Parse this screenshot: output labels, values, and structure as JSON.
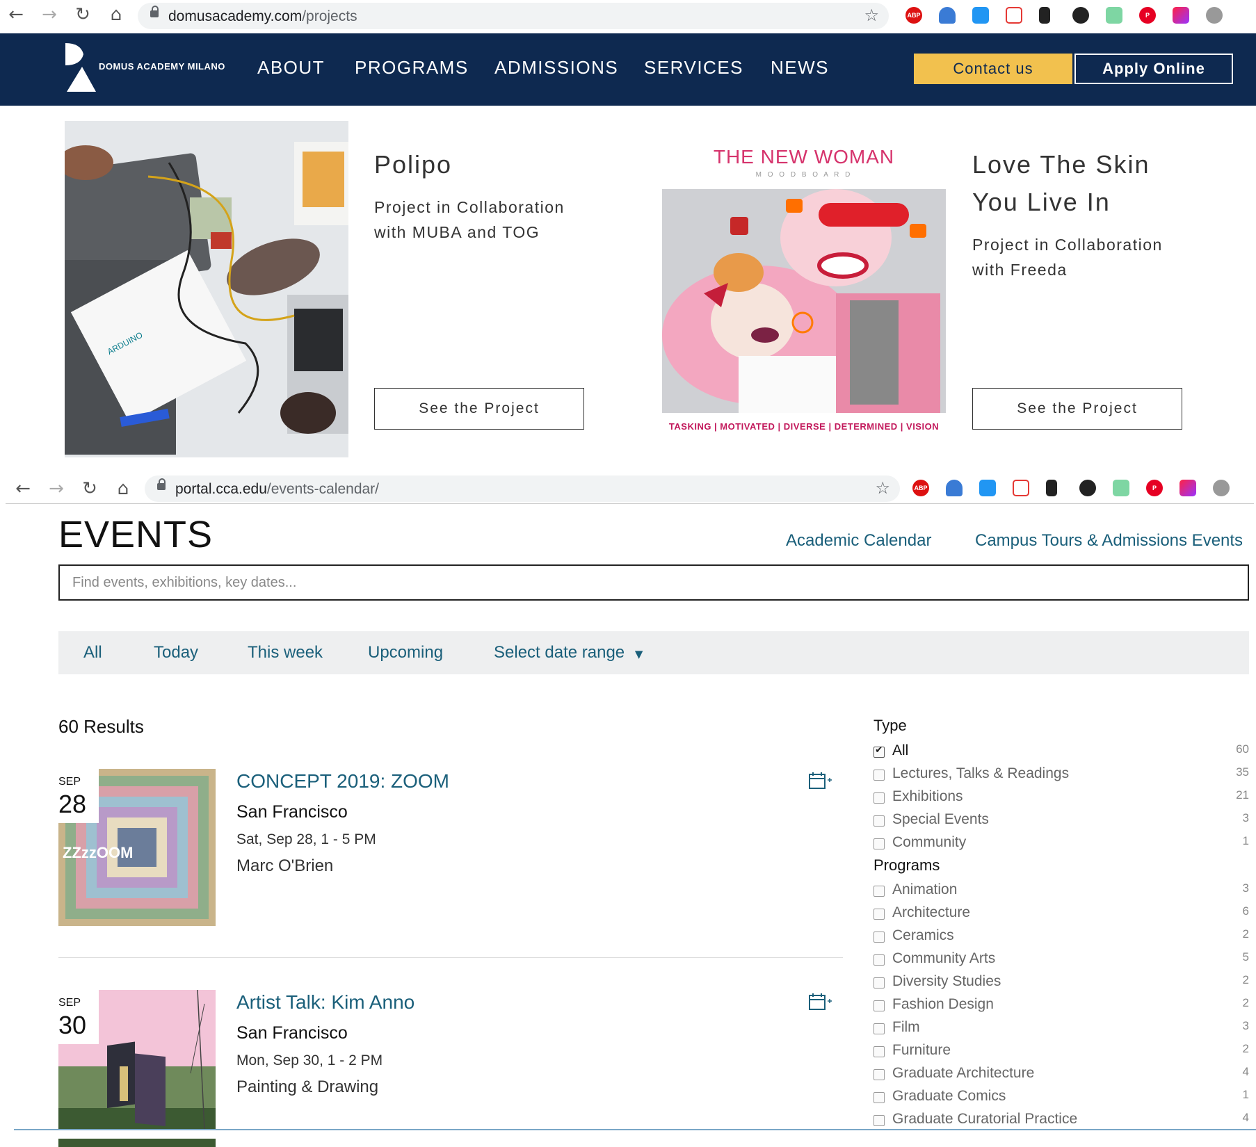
{
  "browser1": {
    "url_host": "domusacademy.com",
    "url_path": "/projects"
  },
  "domus": {
    "brand": "DOMUS ACADEMY MILANO",
    "nav": [
      "ABOUT",
      "PROGRAMS",
      "ADMISSIONS",
      "SERVICES",
      "NEWS"
    ],
    "contact_label": "Contact us",
    "apply_label": "Apply Online",
    "projects": [
      {
        "title": "Polipo",
        "desc_line1": "Project in Collaboration",
        "desc_line2": "with MUBA and TOG",
        "button": "See the Project"
      },
      {
        "title_line1": "Love The Skin",
        "title_line2": "You Live In",
        "desc_line1": "Project in Collaboration",
        "desc_line2": "with Freeda",
        "button": "See the Project",
        "image_title": "THE NEW WOMAN",
        "image_subtitle": "M O O D B O A R D",
        "image_caption": "TASKING | MOTIVATED | DIVERSE | DETERMINED | VISION"
      }
    ],
    "polipo_image_text": "ARDUINO"
  },
  "browser2": {
    "url_host": "portal.cca.edu",
    "url_path": "/events-calendar/"
  },
  "cca": {
    "title": "EVENTS",
    "links": [
      "Academic Calendar",
      "Campus Tours & Admissions Events"
    ],
    "search_placeholder": "Find events, exhibitions, key dates...",
    "filters": [
      "All",
      "Today",
      "This week",
      "Upcoming",
      "Select date range"
    ],
    "results": "60 Results",
    "events": [
      {
        "month": "SEP",
        "day": "28",
        "title": "CONCEPT 2019: ZOOM",
        "location": "San Francisco",
        "time": "Sat, Sep 28, 1 - 5 PM",
        "tag": "Marc O'Brien",
        "image_text": "ZZzzOOM"
      },
      {
        "month": "SEP",
        "day": "30",
        "title": "Artist Talk: Kim Anno",
        "location": "San Francisco",
        "time": "Mon, Sep 30, 1 - 2 PM",
        "tag": "Painting & Drawing"
      }
    ],
    "type_heading": "Type",
    "types": [
      {
        "label": "All",
        "count": "60",
        "checked": true
      },
      {
        "label": "Lectures, Talks & Readings",
        "count": "35"
      },
      {
        "label": "Exhibitions",
        "count": "21"
      },
      {
        "label": "Special Events",
        "count": "3"
      },
      {
        "label": "Community",
        "count": "1"
      }
    ],
    "programs_heading": "Programs",
    "programs": [
      {
        "label": "Animation",
        "count": "3"
      },
      {
        "label": "Architecture",
        "count": "6"
      },
      {
        "label": "Ceramics",
        "count": "2"
      },
      {
        "label": "Community Arts",
        "count": "5"
      },
      {
        "label": "Diversity Studies",
        "count": "2"
      },
      {
        "label": "Fashion Design",
        "count": "2"
      },
      {
        "label": "Film",
        "count": "3"
      },
      {
        "label": "Furniture",
        "count": "2"
      },
      {
        "label": "Graduate Architecture",
        "count": "4"
      },
      {
        "label": "Graduate Comics",
        "count": "1"
      },
      {
        "label": "Graduate Curatorial Practice",
        "count": "4"
      }
    ]
  },
  "extension_icons": [
    "adblock-icon",
    "ghost-icon",
    "window-icon",
    "pocket-icon",
    "lock-icon",
    "fish-icon",
    "audio-icon",
    "pinterest-icon",
    "gradient-app-icon",
    "tomato-icon"
  ],
  "colors": {
    "domus_navy": "#0e2950",
    "domus_gold": "#f2c14e",
    "cca_link": "#1a5f7a"
  }
}
